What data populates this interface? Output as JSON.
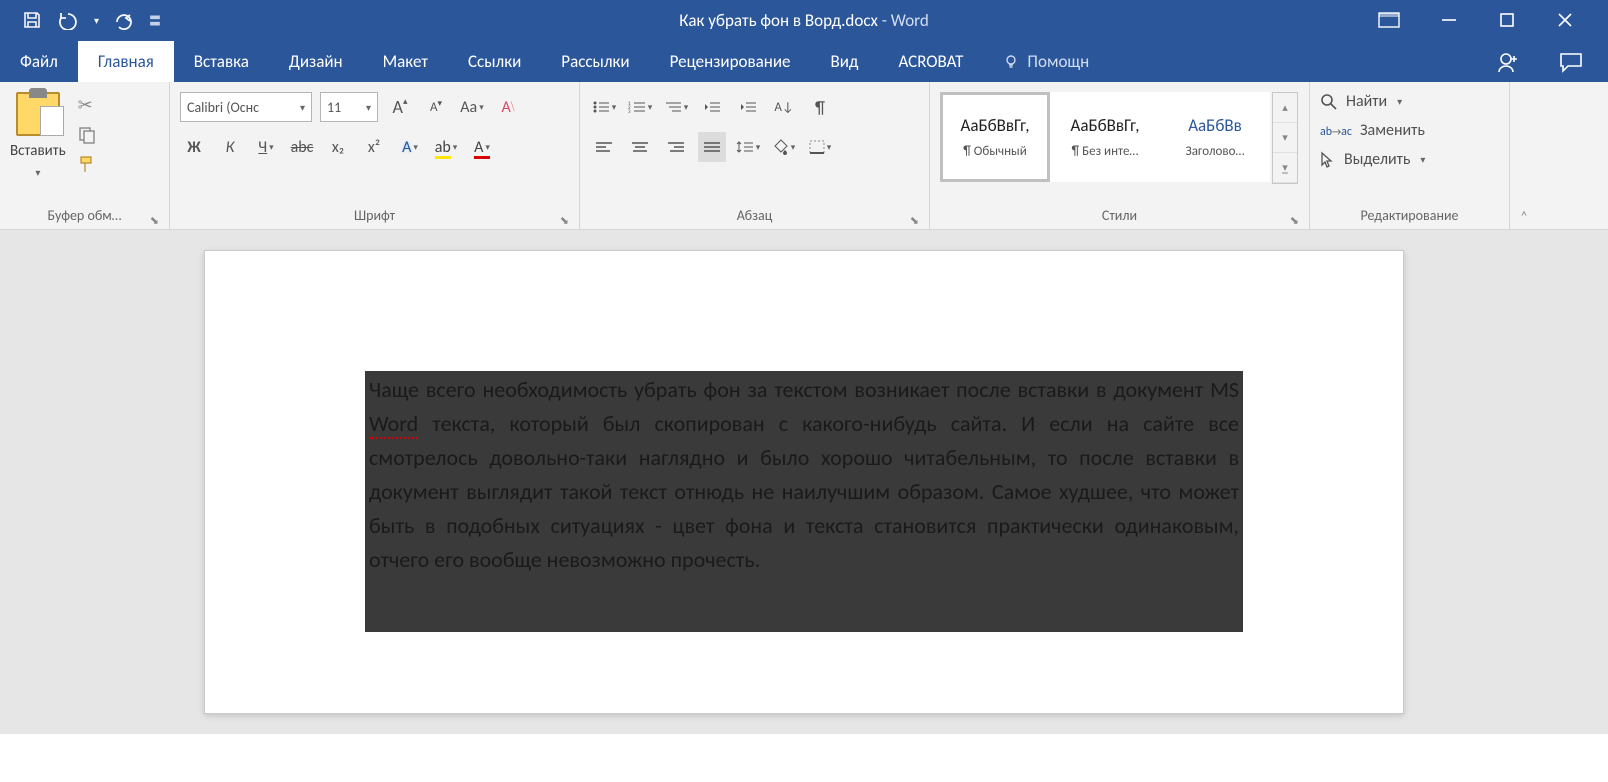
{
  "app": {
    "title_doc": "Как убрать фон в Ворд.docx",
    "title_app": "Word"
  },
  "tabs": {
    "file": "Файл",
    "home": "Главная",
    "insert": "Вставка",
    "design": "Дизайн",
    "layout": "Макет",
    "references": "Ссылки",
    "mailings": "Рассылки",
    "review": "Рецензирование",
    "view": "Вид",
    "acrobat": "ACROBAT",
    "tellme": "Помощн"
  },
  "ribbon": {
    "clipboard": {
      "paste": "Вставить",
      "group_label": "Буфер обм…"
    },
    "font": {
      "font_name": "Calibri (Оснс",
      "font_size": "11",
      "group_label": "Шрифт",
      "bold": "Ж",
      "italic": "К",
      "underline": "Ч",
      "strike": "abc",
      "sub": "x₂",
      "sup": "x²",
      "case": "Aa",
      "bigA": "A",
      "smallA": "A"
    },
    "paragraph": {
      "group_label": "Абзац"
    },
    "styles": {
      "group_label": "Стили",
      "sample": "АаБбВвГг,",
      "sample_heading": "АаБбВв",
      "items": [
        {
          "name": "¶ Обычный"
        },
        {
          "name": "¶ Без инте…"
        },
        {
          "name": "Заголово…"
        }
      ]
    },
    "editing": {
      "group_label": "Редактирование",
      "find": "Найти",
      "replace": "Заменить",
      "select": "Выделить"
    }
  },
  "document": {
    "paragraph_pre": "Чаще всего необходимость убрать фон за текстом возникает после вставки в документ MS ",
    "paragraph_word": "Word",
    "paragraph_post": " текста, который был скопирован с какого-нибудь сайта. И если на сайте все смотрелось довольно-таки наглядно и было хорошо читабельным, то после вставки в документ выглядит такой текст отнюдь не наилучшим образом. Самое худшее, что может быть в подобных ситуациях - цвет фона и текста становится практически одинаковым, отчего его вообще невозможно прочесть."
  }
}
